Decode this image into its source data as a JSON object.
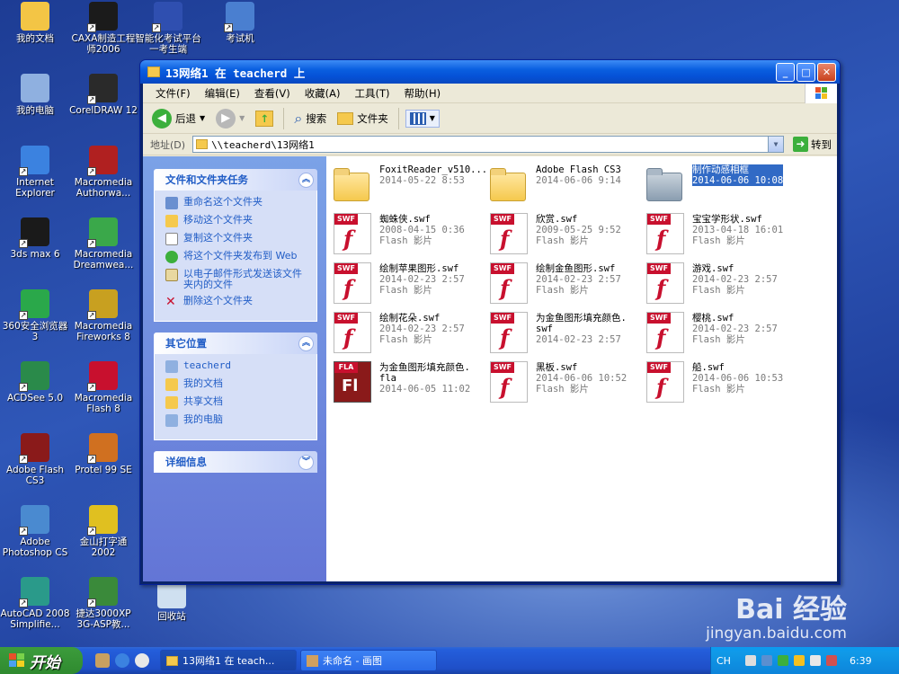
{
  "desktop": {
    "icons": [
      {
        "label": "我的文档",
        "color": "#f3c545"
      },
      {
        "label": "CAXA制造工程师2006",
        "color": "#1b1b1b"
      },
      {
        "label": "智能化考试平台一考生端",
        "color": "#2f4fb0"
      },
      {
        "label": "考试机",
        "color": "#4a7fd0"
      },
      {
        "label": "我的电脑",
        "color": "#8fb0e0"
      },
      {
        "label": "CorelDRAW 12",
        "color": "#2a2a2a"
      },
      {
        "label": "Internet Explorer",
        "color": "#3b82e0"
      },
      {
        "label": "Macromedia Authorwa...",
        "color": "#b02020"
      },
      {
        "label": "3ds max 6",
        "color": "#1a1a1a"
      },
      {
        "label": "Macromedia Dreamwea...",
        "color": "#3aa84a"
      },
      {
        "label": "360安全浏览器 3",
        "color": "#2aa84a"
      },
      {
        "label": "Macromedia Fireworks 8",
        "color": "#c8a020"
      },
      {
        "label": "ACDSee 5.0",
        "color": "#2a8a4a"
      },
      {
        "label": "Macromedia Flash 8",
        "color": "#c8102e"
      },
      {
        "label": "Adobe Flash CS3",
        "color": "#8a1a1a"
      },
      {
        "label": "Protel 99 SE",
        "color": "#d07020"
      },
      {
        "label": "Adobe Photoshop CS",
        "color": "#4a8ad0"
      },
      {
        "label": "金山打字通 2002",
        "color": "#e0c020"
      },
      {
        "label": "AutoCAD 2008 Simplifie...",
        "color": "#2a9a8a"
      },
      {
        "label": "捷达3000XP 3G-ASP教...",
        "color": "#3a8a3a"
      },
      {
        "label": "回收站",
        "color": "#cfe0f0"
      }
    ]
  },
  "window": {
    "title": "13网络1 在 teacherd 上",
    "menu": [
      "文件(F)",
      "编辑(E)",
      "查看(V)",
      "收藏(A)",
      "工具(T)",
      "帮助(H)"
    ],
    "toolbar": {
      "back": "后退",
      "search": "搜索",
      "folders": "文件夹"
    },
    "address": {
      "label": "地址(D)",
      "value": "\\\\teacherd\\13网络1",
      "go": "转到"
    },
    "tasks": {
      "header": "文件和文件夹任务",
      "items": [
        "重命名这个文件夹",
        "移动这个文件夹",
        "复制这个文件夹",
        "将这个文件夹发布到 Web",
        "以电子邮件形式发送该文件夹内的文件",
        "删除这个文件夹"
      ]
    },
    "places": {
      "header": "其它位置",
      "items": [
        "teacherd",
        "我的文档",
        "共享文档",
        "我的电脑"
      ]
    },
    "details": {
      "header": "详细信息"
    },
    "files": [
      {
        "name": "FoxitReader_v510...",
        "line2": "2014-05-22 8:53",
        "line3": "",
        "type": "folder"
      },
      {
        "name": "Adobe Flash CS3",
        "line2": "2014-06-06 9:14",
        "line3": "",
        "type": "folder"
      },
      {
        "name": "制作动感相框",
        "line2": "2014-06-06 10:08",
        "line3": "",
        "type": "folder-grey"
      },
      {
        "name": "蜘蛛侠.swf",
        "line2": "2008-04-15 0:36",
        "line3": "Flash 影片",
        "type": "swf"
      },
      {
        "name": "欣赏.swf",
        "line2": "2009-05-25 9:52",
        "line3": "Flash 影片",
        "type": "swf"
      },
      {
        "name": "宝宝学形状.swf",
        "line2": "2013-04-18 16:01",
        "line3": "Flash 影片",
        "type": "swf"
      },
      {
        "name": "绘制苹果图形.swf",
        "line2": "2014-02-23 2:57",
        "line3": "Flash 影片",
        "type": "swf"
      },
      {
        "name": "绘制金鱼图形.swf",
        "line2": "2014-02-23 2:57",
        "line3": "Flash 影片",
        "type": "swf"
      },
      {
        "name": "游戏.swf",
        "line2": "2014-02-23 2:57",
        "line3": "Flash 影片",
        "type": "swf"
      },
      {
        "name": "绘制花朵.swf",
        "line2": "2014-02-23 2:57",
        "line3": "Flash 影片",
        "type": "swf"
      },
      {
        "name": "为金鱼图形填充颜色.",
        "line2": "swf",
        "line3": "2014-02-23 2:57",
        "type": "swf"
      },
      {
        "name": "樱桃.swf",
        "line2": "2014-02-23 2:57",
        "line3": "Flash 影片",
        "type": "swf"
      },
      {
        "name": "为金鱼图形填充颜色.",
        "line2": "fla",
        "line3": "2014-06-05 11:02",
        "type": "fla"
      },
      {
        "name": "黑板.swf",
        "line2": "2014-06-06 10:52",
        "line3": "Flash 影片",
        "type": "swf"
      },
      {
        "name": "船.swf",
        "line2": "2014-06-06 10:53",
        "line3": "Flash 影片",
        "type": "swf"
      }
    ]
  },
  "taskbar": {
    "start": "开始",
    "tasks": [
      "13网络1 在 teach...",
      "未命名 - 画图"
    ],
    "lang": "CH",
    "clock": "6:39"
  },
  "watermark": {
    "brand": "Bai 经验",
    "url": "jingyan.baidu.com"
  }
}
